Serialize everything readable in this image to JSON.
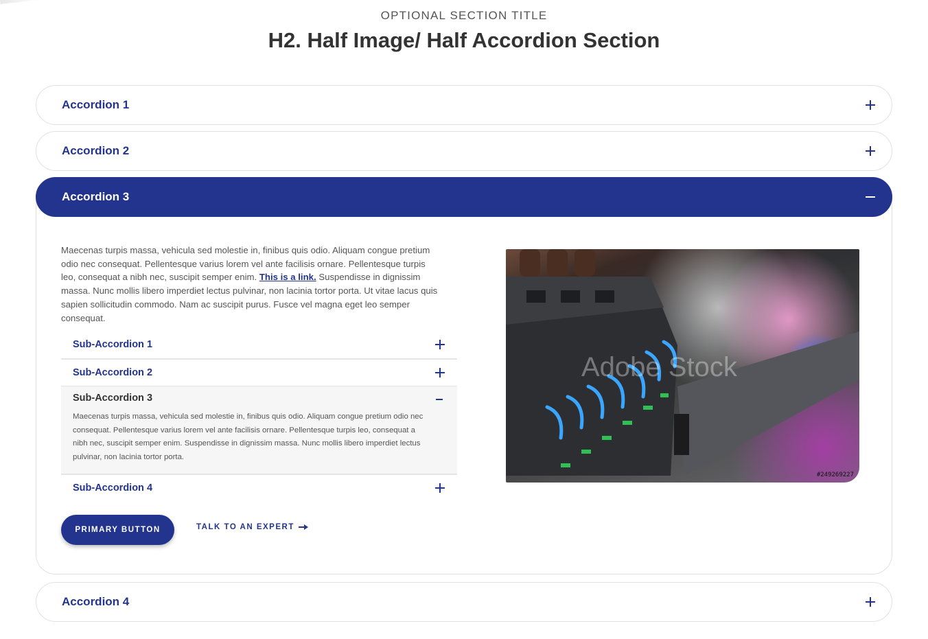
{
  "section": {
    "eyebrow": "OPTIONAL SECTION TITLE",
    "title": "H2. Half Image/ Half Accordion Section"
  },
  "accordions": [
    {
      "label": "Accordion 1",
      "state": "collapsed",
      "icon": "plus-icon"
    },
    {
      "label": "Accordion 2",
      "state": "collapsed",
      "icon": "plus-icon"
    },
    {
      "label": "Accordion 3",
      "state": "expanded",
      "icon": "minus-icon"
    },
    {
      "label": "Accordion 4",
      "state": "collapsed",
      "icon": "plus-icon"
    }
  ],
  "panel": {
    "body_before_link": "Maecenas turpis massa, vehicula sed molestie in, finibus quis odio. Aliquam congue pretium odio nec consequat. Pellentesque varius lorem vel ante facilisis ornare. Pellentesque turpis leo, consequat a nibh nec, suscipit semper enim.",
    "link_text": "This is a link.",
    "body_after_link": "Suspendisse in dignissim massa. Nunc mollis libero imperdiet lectus pulvinar, non lacinia tortor porta. Ut vitae lacus quis sapien sollicitudin commodo. Nam ac suscipit purus. Fusce vel magna eget leo semper consequat.",
    "sub_accordions": [
      {
        "label": "Sub-Accordion 1",
        "state": "collapsed"
      },
      {
        "label": "Sub-Accordion 2",
        "state": "collapsed"
      },
      {
        "label": "Sub-Accordion 3",
        "state": "expanded",
        "content": "Maecenas turpis massa, vehicula sed molestie in, finibus quis odio. Aliquam congue pretium odio nec consequat. Pellentesque varius lorem vel ante facilisis ornare. Pellentesque turpis leo, consequat a nibh nec, suscipit semper enim. Suspendisse in dignissim massa. Nunc mollis libero imperdiet lectus pulvinar, non lacinia tortor porta."
      },
      {
        "label": "Sub-Accordion 4",
        "state": "collapsed"
      }
    ],
    "primary_button": "PRIMARY BUTTON",
    "secondary_link": "TALK TO AN EXPERT",
    "image": {
      "watermark": "Adobe Stock",
      "stock_id": "#249269227"
    }
  },
  "colors": {
    "brand": "#23348f",
    "border": "#e2e2e2",
    "sub_panel_bg": "#f6f6f6"
  }
}
